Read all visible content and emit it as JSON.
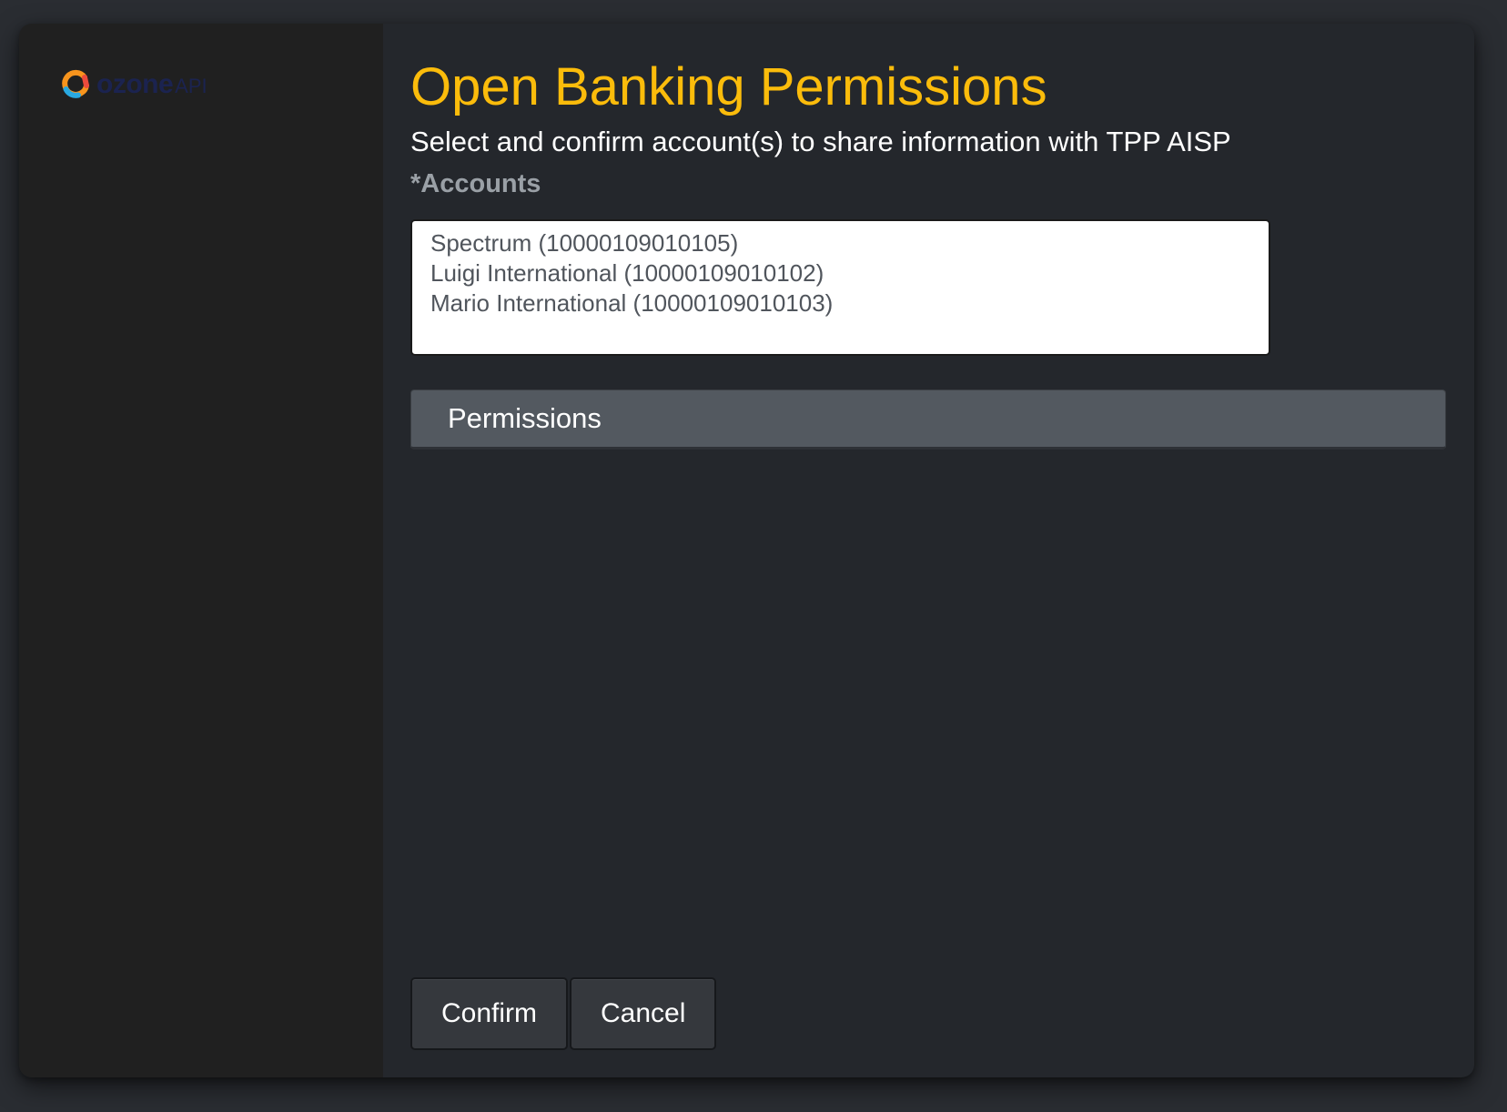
{
  "brand": {
    "logo_word": "ozone",
    "logo_suffix": "API",
    "colors": {
      "accent": "#fbbc0b",
      "logo_text": "#1b2350",
      "logo_mark_orange": "#f7941d",
      "logo_mark_red": "#ec4a3c",
      "logo_mark_blue": "#29a9e1"
    }
  },
  "header": {
    "title": "Open Banking Permissions",
    "subtitle": "Select and confirm account(s) to share information with TPP AISP"
  },
  "accounts": {
    "label": "*Accounts",
    "options": [
      "Spectrum (10000109010105)",
      "Luigi International (10000109010102)",
      "Mario International (10000109010103)"
    ]
  },
  "permissions": {
    "label": "Permissions"
  },
  "actions": {
    "confirm_label": "Confirm",
    "cancel_label": "Cancel"
  }
}
